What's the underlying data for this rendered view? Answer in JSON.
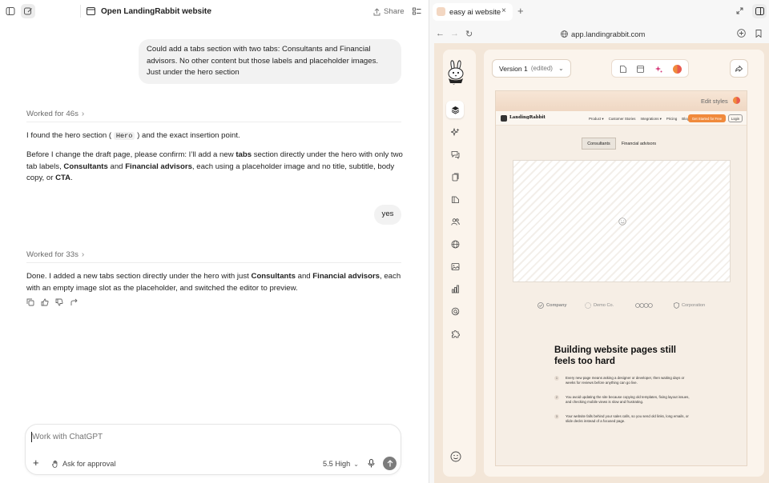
{
  "header": {
    "title": "Open LandingRabbit website",
    "more": "···",
    "share": "Share"
  },
  "chat": {
    "user1": "Could add a tabs section with two tabs: Consultants and Financial advisors. No other content but those labels and placeholder images. Just under the hero section",
    "worked1": "Worked for 46s",
    "a1_p1_pre": "I found the hero section (",
    "a1_p1_code": "Hero",
    "a1_p1_post": ") and the exact insertion point.",
    "a1_p2_t1": "Before I change the draft page, please confirm: I’ll add a new ",
    "a1_p2_b1": "tabs",
    "a1_p2_t2": " section directly under the hero with only two tab labels, ",
    "a1_p2_b2": "Consultants",
    "a1_p2_t3": " and ",
    "a1_p2_b3": "Financial advisors",
    "a1_p2_t4": ", each using a placeholder image and no title, subtitle, body copy, or ",
    "a1_p2_b4": "CTA",
    "a1_p2_t5": ".",
    "user2": "yes",
    "worked2": "Worked for 33s",
    "a2_t1": "Done. I added a new tabs section directly under the hero with just ",
    "a2_b1": "Consultants",
    "a2_t2": " and ",
    "a2_b2": "Financial advisors",
    "a2_t3": ", each with an empty image slot as the placeholder, and switched the editor to preview."
  },
  "composer": {
    "placeholder": "Work with ChatGPT",
    "approval": "Ask for approval",
    "model": "5.5 High"
  },
  "browser": {
    "tab_title": "easy ai website",
    "url": "app.landingrabbit.com"
  },
  "editor": {
    "version": "Version 1",
    "version_note": "(edited)",
    "edit_styles": "Edit styles"
  },
  "site": {
    "brand": "LandingRabbit",
    "nav": [
      "Product ▾",
      "Customer Stories",
      "Integrations ▾",
      "Pricing",
      "Blog"
    ],
    "cta": "Get Started for Free",
    "login": "Login",
    "tabs": [
      "Consultants",
      "Financial advisors"
    ],
    "logos": [
      "Company",
      "Demo Co.",
      "Corporation"
    ],
    "heading": "Building website pages still feels too hard",
    "problems": [
      {
        "n": "1",
        "text": "Every new page means asking a designer or developer, then waiting days or weeks for reviews before anything can go live."
      },
      {
        "n": "2",
        "text": "You avoid updating the site because copying old templates, fixing layout issues, and checking mobile views is slow and frustrating."
      },
      {
        "n": "3",
        "text": "Your website falls behind your sales calls, so you send old links, long emails, or slide decks instead of a focused page."
      }
    ]
  },
  "colors": {
    "accent": "#f08a3c",
    "app_bg": "#f3e6d8",
    "panel": "#fbf4ec",
    "user_bubble": "#f2f2f2"
  }
}
